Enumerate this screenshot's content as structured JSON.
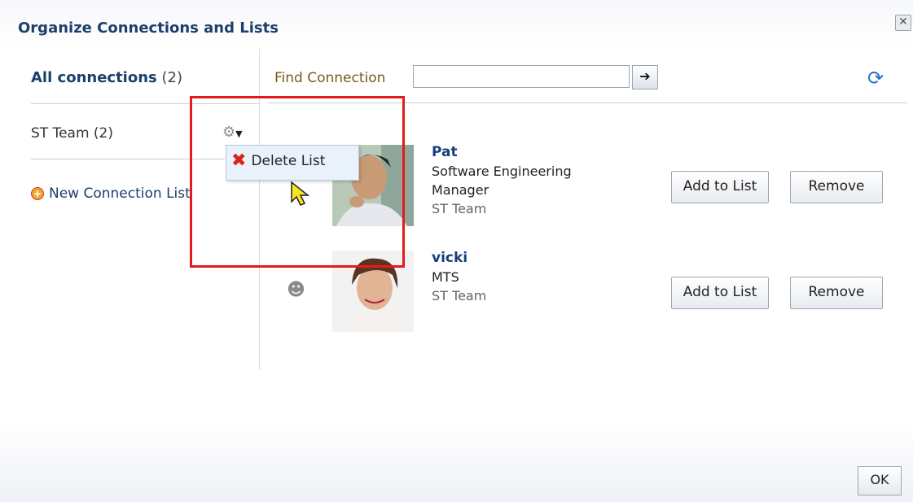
{
  "dialog": {
    "title": "Organize Connections and Lists",
    "close_label": "✕"
  },
  "left": {
    "all_connections_label": "All connections",
    "all_connections_count": "(2)",
    "lists": [
      {
        "label": "ST Team",
        "count": "(2)"
      }
    ],
    "new_list_label": "New Connection List",
    "gear_icon": "gear-icon"
  },
  "menu": {
    "items": [
      {
        "label": "Delete List",
        "icon": "delete-icon"
      }
    ]
  },
  "search": {
    "label": "Find Connection",
    "value": "",
    "placeholder": ""
  },
  "connections": [
    {
      "name": "Pat",
      "title_line1": "Software Engineering",
      "title_line2": "Manager",
      "list": "ST Team",
      "add_label": "Add to List",
      "remove_label": "Remove"
    },
    {
      "name": "vicki",
      "title_line1": "MTS",
      "title_line2": "",
      "list": "ST Team",
      "add_label": "Add to List",
      "remove_label": "Remove"
    }
  ],
  "footer": {
    "ok_label": "OK"
  },
  "colors": {
    "title": "#1c3f6e",
    "highlight": "#e21b1b",
    "menu_bg": "#e9f2fb"
  }
}
